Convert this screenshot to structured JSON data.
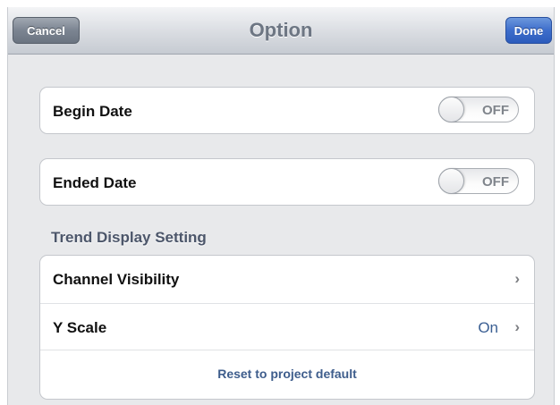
{
  "navbar": {
    "title": "Option",
    "cancel_label": "Cancel",
    "done_label": "Done"
  },
  "begin_date": {
    "label": "Begin Date",
    "toggle_text": "OFF",
    "state": "off"
  },
  "ended_date": {
    "label": "Ended Date",
    "toggle_text": "OFF",
    "state": "off"
  },
  "trend_section": {
    "header": "Trend Display Setting",
    "rows": [
      {
        "label": "Channel Visibility",
        "value": ""
      },
      {
        "label": "Y Scale",
        "value": "On"
      }
    ],
    "reset_label": "Reset to project default"
  },
  "icons": {
    "disclosure": "chevron-right-icon"
  },
  "colors": {
    "accent_blue": "#3d6dcb",
    "value_blue": "#3b5f93",
    "section_header": "#4c566a"
  }
}
